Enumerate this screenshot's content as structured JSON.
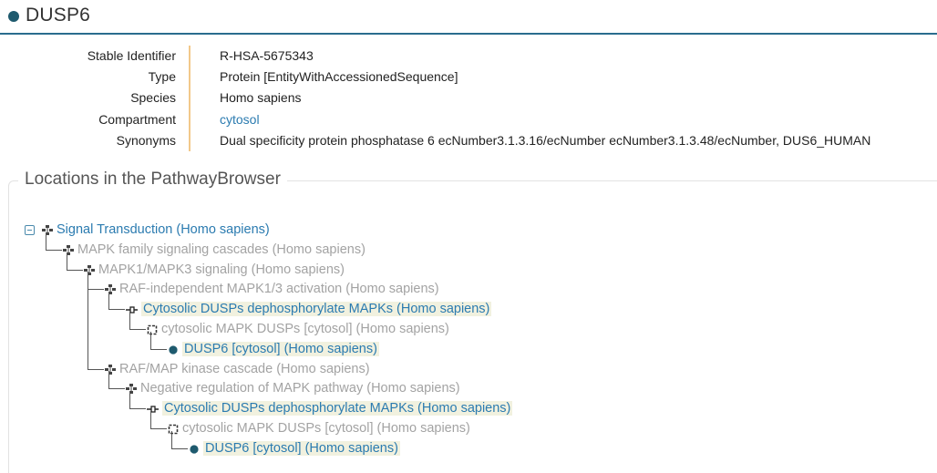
{
  "header": {
    "title": "DUSP6"
  },
  "details": {
    "rows": [
      {
        "key": "Stable Identifier",
        "value": "R-HSA-5675343"
      },
      {
        "key": "Type",
        "value": "Protein [EntityWithAccessionedSequence]"
      },
      {
        "key": "Species",
        "value": "Homo sapiens"
      },
      {
        "key": "Compartment",
        "value": "cytosol"
      },
      {
        "key": "Synonyms",
        "value": "Dual specificity protein phosphatase 6 ecNumber3.1.3.16/ecNumber ecNumber3.1.3.48/ecNumber, DUS6_HUMAN"
      }
    ]
  },
  "locations": {
    "legend": "Locations in the PathwayBrowser",
    "tree": [
      {
        "label": "Signal Transduction (Homo sapiens)",
        "icon": "pathway-icon",
        "style": "blue"
      },
      {
        "label": "MAPK family signaling cascades (Homo sapiens)",
        "icon": "pathway-icon",
        "style": "grey"
      },
      {
        "label": "MAPK1/MAPK3 signaling (Homo sapiens)",
        "icon": "pathway-icon",
        "style": "grey"
      },
      {
        "label": "RAF-independent MAPK1/3 activation (Homo sapiens)",
        "icon": "pathway-icon",
        "style": "grey"
      },
      {
        "label": "Cytosolic DUSPs dephosphorylate MAPKs (Homo sapiens)",
        "icon": "reaction-icon",
        "style": "blue-hl"
      },
      {
        "label": "cytosolic MAPK DUSPs [cytosol] (Homo sapiens)",
        "icon": "complex-icon",
        "style": "grey"
      },
      {
        "label": "DUSP6 [cytosol] (Homo sapiens)",
        "icon": "protein-icon",
        "style": "blue-hl"
      },
      {
        "label": "RAF/MAP kinase cascade (Homo sapiens)",
        "icon": "pathway-icon",
        "style": "grey"
      },
      {
        "label": "Negative regulation of MAPK pathway (Homo sapiens)",
        "icon": "pathway-icon",
        "style": "grey"
      },
      {
        "label": "Cytosolic DUSPs dephosphorylate MAPKs (Homo sapiens)",
        "icon": "reaction-icon",
        "style": "blue-hl"
      },
      {
        "label": "cytosolic MAPK DUSPs [cytosol] (Homo sapiens)",
        "icon": "complex-icon",
        "style": "grey"
      },
      {
        "label": "DUSP6 [cytosol] (Homo sapiens)",
        "icon": "protein-icon",
        "style": "blue-hl"
      }
    ]
  },
  "colors": {
    "accent": "#2a6d8e",
    "link": "#2b7bb0",
    "separator": "#f2c88a",
    "highlight": "#f1f1df"
  }
}
